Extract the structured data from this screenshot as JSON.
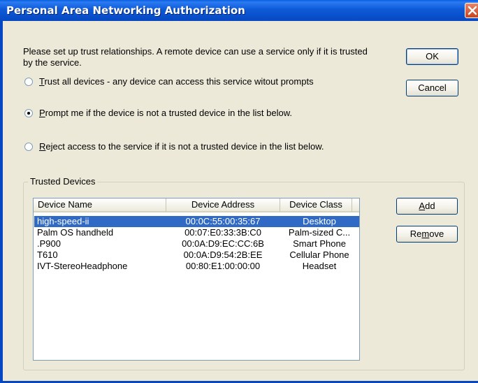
{
  "window": {
    "title": "Personal Area Networking Authorization"
  },
  "intro": "Please set up trust relationships. A remote device can use a service only if it is trusted by the service.",
  "buttons": {
    "ok": "OK",
    "cancel": "Cancel",
    "add": "Add",
    "remove": "Remove"
  },
  "options": [
    {
      "mnemonic": "T",
      "rest": "rust all devices - any device can access this service witout prompts",
      "checked": false
    },
    {
      "mnemonic": "P",
      "rest": "rompt me if the device is not a trusted device in the list below.",
      "checked": true
    },
    {
      "mnemonic": "R",
      "rest": "eject access to the service if it is not a trusted device in the list below.",
      "checked": false
    }
  ],
  "trusted": {
    "group_label": "Trusted Devices",
    "columns": [
      "Device Name",
      "Device Address",
      "Device Class"
    ],
    "rows": [
      {
        "name": "high-speed-ii",
        "address": "00:0C:55:00:35:67",
        "class": "Desktop",
        "selected": true
      },
      {
        "name": "Palm OS handheld",
        "address": "00:07:E0:33:3B:C0",
        "class": "Palm-sized C...",
        "selected": false
      },
      {
        "name": ".P900",
        "address": "00:0A:D9:EC:CC:6B",
        "class": "Smart Phone",
        "selected": false
      },
      {
        "name": "T610",
        "address": "00:0A:D9:54:2B:EE",
        "class": "Cellular Phone",
        "selected": false
      },
      {
        "name": "IVT-StereoHeadphone",
        "address": "00:80:E1:00:00:00",
        "class": "Headset",
        "selected": false
      }
    ]
  },
  "colors": {
    "title_bar": "#0748c2",
    "selection": "#316ac5",
    "dialog_bg": "#ece9d8"
  }
}
